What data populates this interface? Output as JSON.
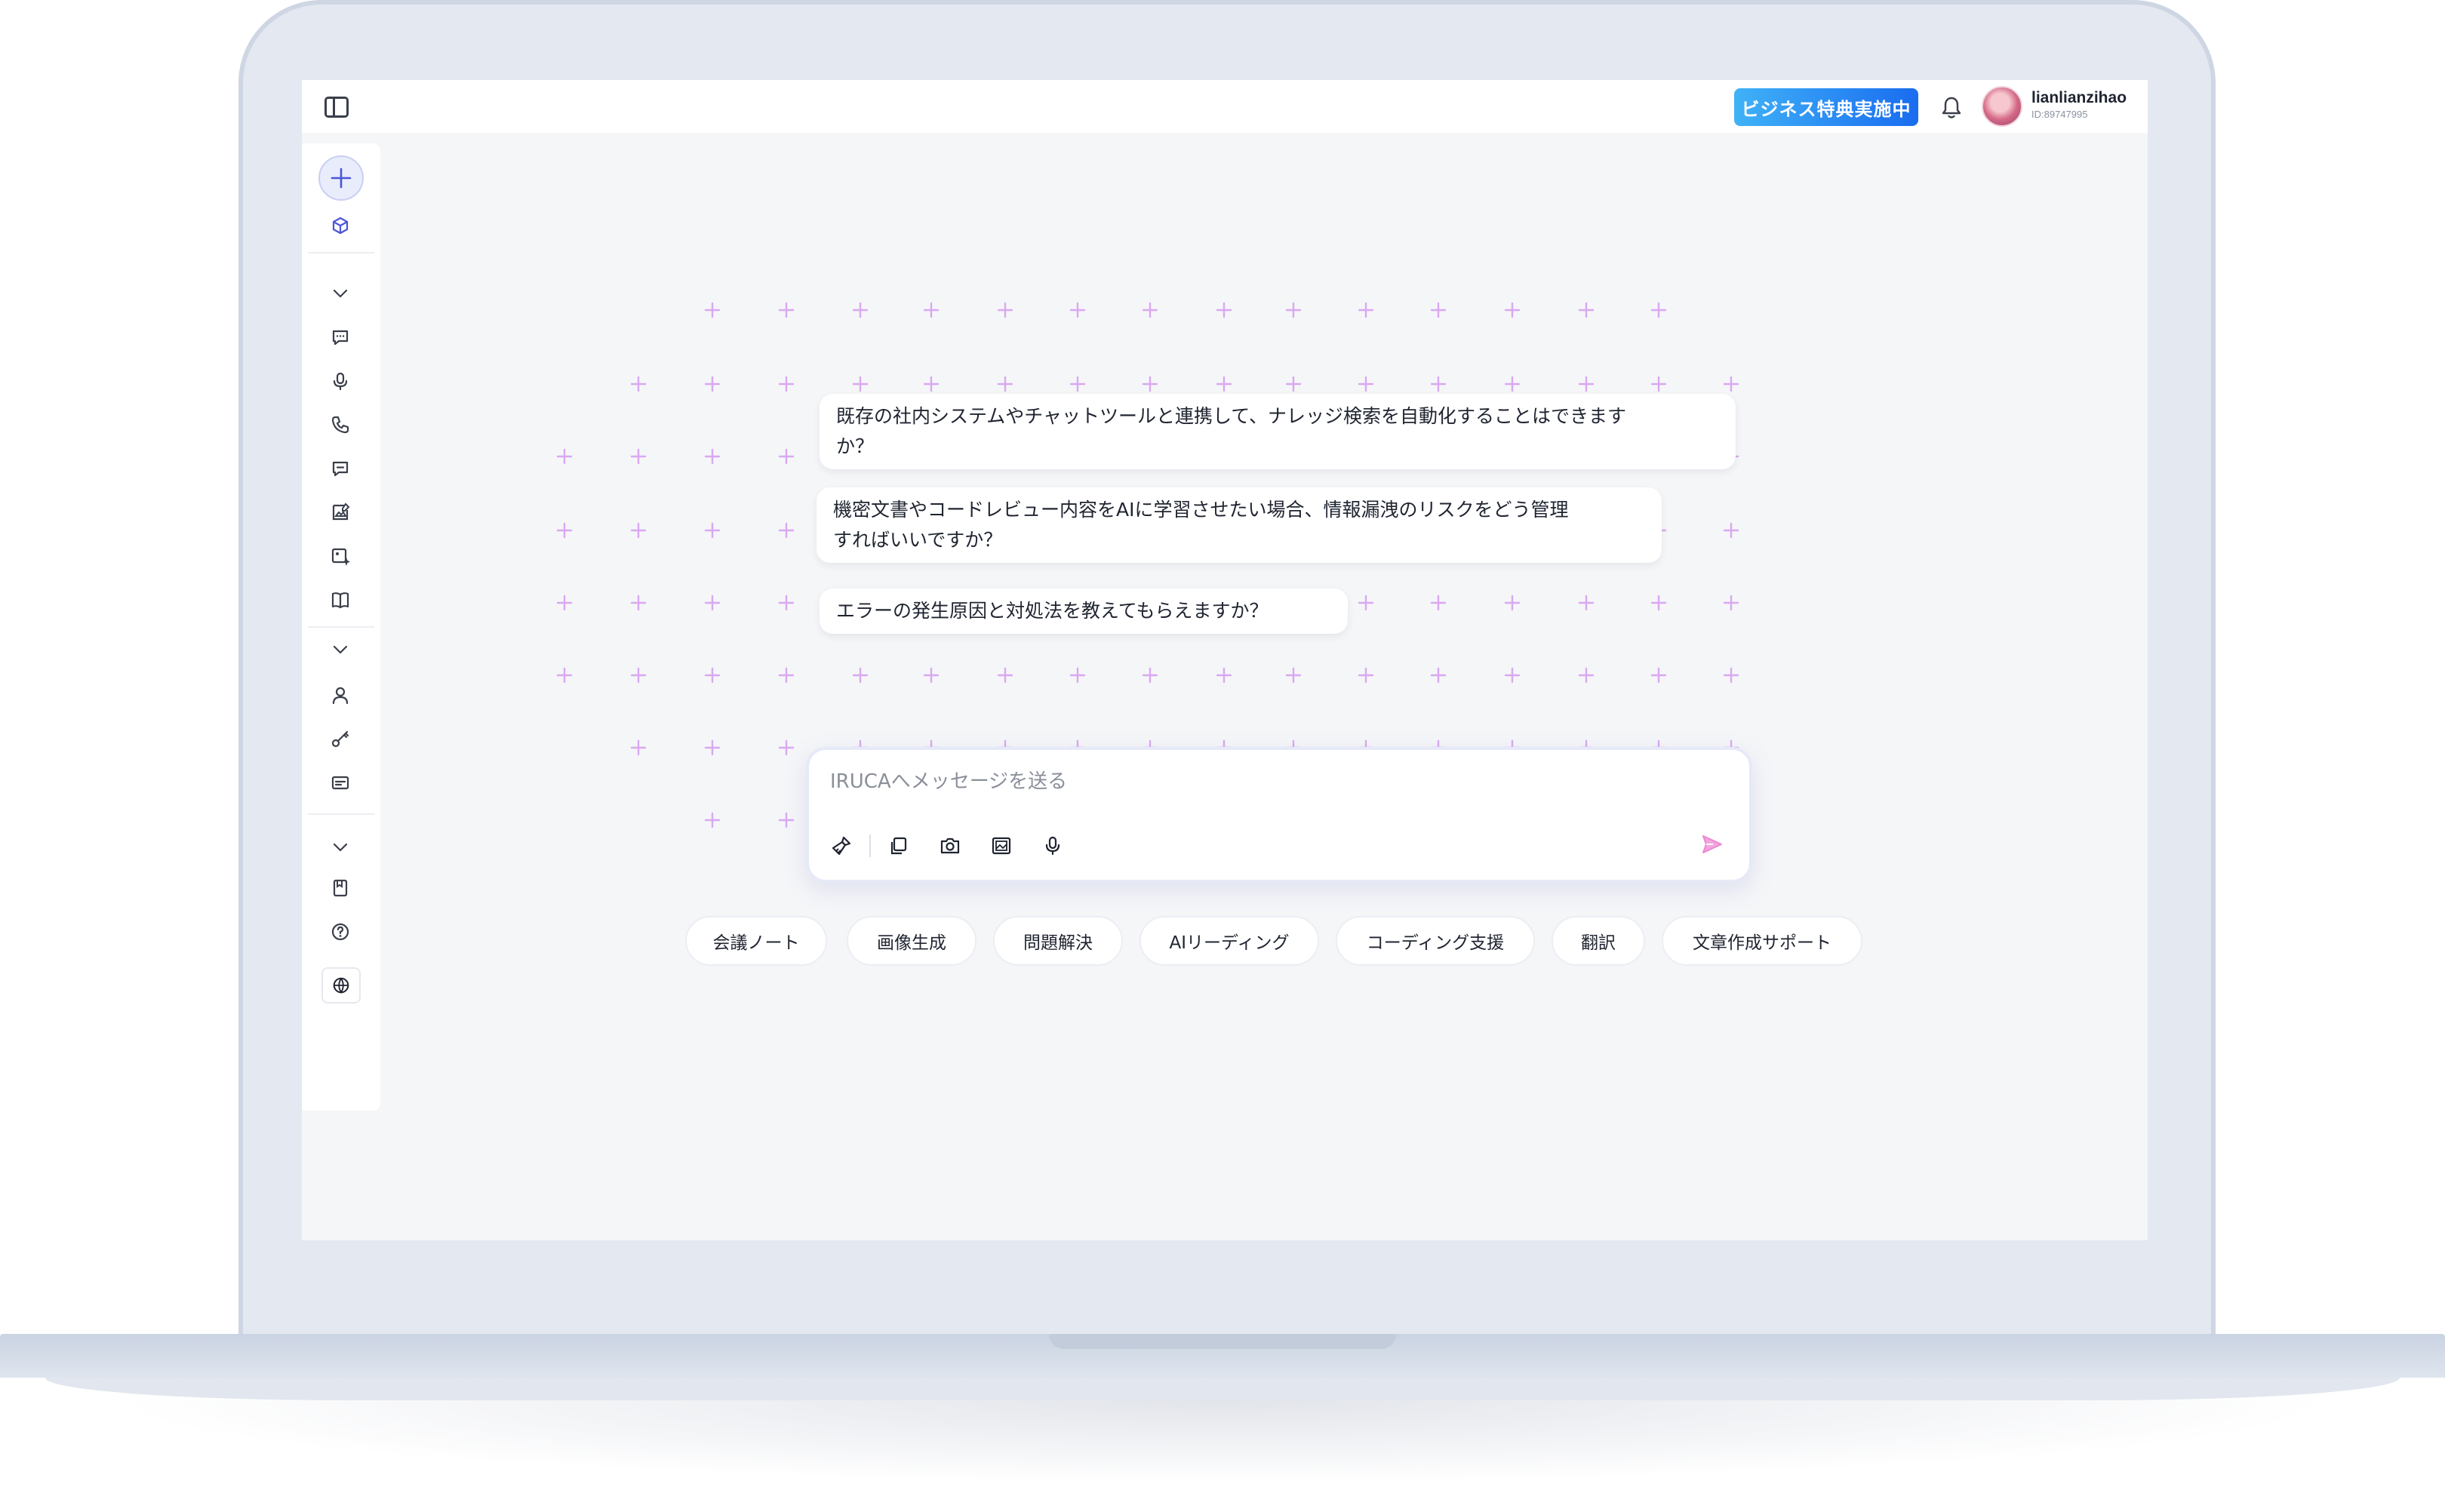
{
  "header": {
    "promo_label": "ビジネス特典実施中",
    "user_name": "lianlianzihao",
    "user_id": "ID:89747995"
  },
  "sidebar": {
    "icons": [
      "new-chat-icon",
      "cube-icon",
      "chevron-down-icon",
      "chat-icon",
      "microphone-icon",
      "phone-icon",
      "chat-bubble-icon",
      "image-edit-icon",
      "image-sparkle-icon",
      "book-icon",
      "chevron-down-icon",
      "user-icon",
      "key-icon",
      "card-icon",
      "chevron-down-icon",
      "bookmark-icon",
      "help-icon",
      "globe-icon"
    ]
  },
  "suggestions": [
    {
      "line1": "既存の社内システムやチャットツールと連携して、ナレッジ検索を自動化することはできます",
      "line2": "か？"
    },
    {
      "line1": "機密文書やコードレビュー内容をAIに学習させたい場合、情報漏洩のリスクをどう管理",
      "line2": "すればいいですか？"
    },
    {
      "line1": "エラーの発生原因と対処法を教えてもらえますか？",
      "line2": ""
    }
  ],
  "composer": {
    "placeholder": "IRUCAへメッセージを送る",
    "tools": [
      "brush-icon",
      "copy-icon",
      "camera-icon",
      "image-icon",
      "microphone-icon"
    ]
  },
  "chips": [
    "会議ノート",
    "画像生成",
    "問題解決",
    "AIリーディング",
    "コーディング支援",
    "翻訳",
    "文章作成サポート"
  ],
  "colors": {
    "accent_blue": "#1a6cf0",
    "plus_purple": "#d9a8f2",
    "send_pink": "#f08ad6",
    "screen_bg": "#f5f6f8",
    "frame": "#e3e8f1"
  }
}
